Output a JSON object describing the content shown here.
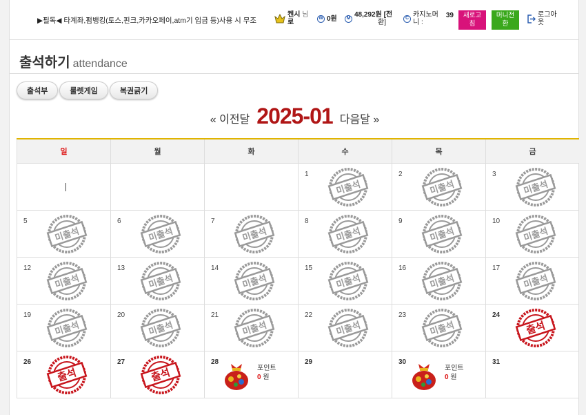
{
  "topbar": {
    "notice": "▶필독◀ 타계좌,펌뱅킹(토스,핀크,카카오페이,atm기 입금 등)사용 시 무조",
    "user_name": "켄시",
    "user_suffix": "님",
    "user_line2": "로",
    "coin1": "0원",
    "coin2_a": "48,292원 [전",
    "coin2_b": "환]",
    "casino_a": "카지노머",
    "casino_b": "니 :",
    "casino_value": "39",
    "refresh_a": "새로고",
    "refresh_b": "침",
    "money_a": "머니전",
    "money_b": "환",
    "logout_a": "로그아",
    "logout_b": "웃",
    "colors": {
      "refresh": "#d8127a",
      "money": "#3aa81c"
    }
  },
  "page": {
    "title": "출석하기",
    "subtitle": "attendance"
  },
  "tabs": [
    "출석부",
    "룰렛게임",
    "복권긁기"
  ],
  "month": {
    "prev": "« 이전달",
    "current": "2025-01",
    "next": "다음달 »"
  },
  "weekdays": [
    "일",
    "월",
    "화",
    "수",
    "목",
    "금"
  ],
  "weeks": [
    [
      {
        "day": ""
      },
      {
        "day": ""
      },
      {
        "day": ""
      },
      {
        "day": "1",
        "status": "absent"
      },
      {
        "day": "2",
        "status": "absent"
      },
      {
        "day": "3",
        "status": "absent"
      }
    ],
    [
      {
        "day": "5",
        "status": "absent"
      },
      {
        "day": "6",
        "status": "absent"
      },
      {
        "day": "7",
        "status": "absent"
      },
      {
        "day": "8",
        "status": "absent"
      },
      {
        "day": "9",
        "status": "absent"
      },
      {
        "day": "10",
        "status": "absent"
      }
    ],
    [
      {
        "day": "12",
        "status": "absent"
      },
      {
        "day": "13",
        "status": "absent"
      },
      {
        "day": "14",
        "status": "absent"
      },
      {
        "day": "15",
        "status": "absent"
      },
      {
        "day": "16",
        "status": "absent"
      },
      {
        "day": "17",
        "status": "absent"
      }
    ],
    [
      {
        "day": "19",
        "status": "absent"
      },
      {
        "day": "20",
        "status": "absent"
      },
      {
        "day": "21",
        "status": "absent"
      },
      {
        "day": "22",
        "status": "absent"
      },
      {
        "day": "23",
        "status": "absent"
      },
      {
        "day": "24",
        "status": "present"
      }
    ],
    [
      {
        "day": "26",
        "status": "present"
      },
      {
        "day": "27",
        "status": "present"
      },
      {
        "day": "28",
        "status": "reward"
      },
      {
        "day": "29"
      },
      {
        "day": "30",
        "status": "reward"
      },
      {
        "day": "31"
      }
    ]
  ],
  "stamps": {
    "absent": "미출석",
    "present": "출석"
  },
  "reward": {
    "label": "포인트",
    "amount": "0",
    "unit": "원"
  }
}
